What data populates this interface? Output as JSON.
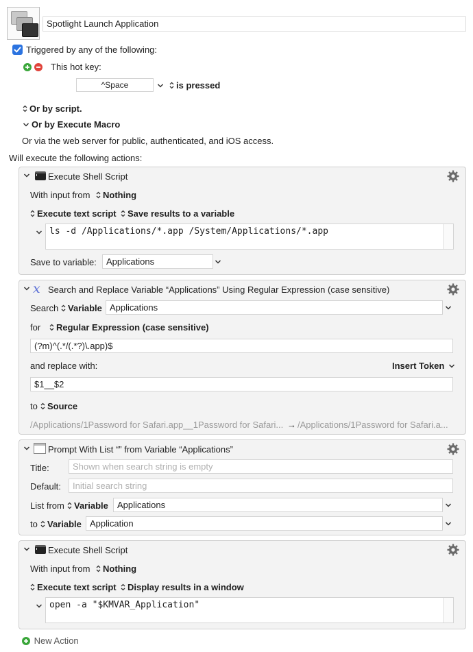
{
  "macro": {
    "name": "Spotlight Launch Application"
  },
  "trigger": {
    "label": "Triggered by any of the following:",
    "hotkey_label": "This hot key:",
    "hotkey_value": "^Space",
    "hotkey_mode": "is pressed",
    "or_script": "Or by script.",
    "or_execute_macro": "Or by Execute Macro",
    "or_web": "Or via the web server for public, authenticated, and iOS access."
  },
  "actions_label": "Will execute the following actions:",
  "action1": {
    "title": "Execute Shell Script",
    "input_from_label": "With input from",
    "input_from_value": "Nothing",
    "execute_mode": "Execute text script",
    "result_mode": "Save results to a variable",
    "script": "ls -d /Applications/*.app /System/Applications/*.app",
    "save_to_label": "Save to variable:",
    "save_to_value": "Applications"
  },
  "action2": {
    "title": "Search and Replace Variable “Applications” Using Regular Expression (case sensitive)",
    "search_label": "Search",
    "search_type": "Variable",
    "search_value": "Applications",
    "for_label": "for",
    "for_type": "Regular Expression (case sensitive)",
    "regex": "(?m)^(.*/(.*?)\\.app)$",
    "replace_label": "and replace with:",
    "insert_token": "Insert Token",
    "replacement": "$1__$2",
    "to_label": "to",
    "to_value": "Source",
    "preview_before": "/Applications/1Password for Safari.app__1Password for Safari...",
    "preview_arrow": "→",
    "preview_after": "/Applications/1Password for Safari.a..."
  },
  "action3": {
    "title": "Prompt With List “” from Variable “Applications”",
    "title_label": "Title:",
    "title_placeholder": "Shown when search string is empty",
    "default_label": "Default:",
    "default_placeholder": "Initial search string",
    "list_from_label": "List from",
    "list_from_type": "Variable",
    "list_from_value": "Applications",
    "to_label": "to",
    "to_type": "Variable",
    "to_value": "Application"
  },
  "action4": {
    "title": "Execute Shell Script",
    "input_from_label": "With input from",
    "input_from_value": "Nothing",
    "execute_mode": "Execute text script",
    "result_mode": "Display results in a window",
    "script": "open -a \"$KMVAR_Application\""
  },
  "new_action": "New Action",
  "colors": {
    "checkbox": "#2b73e0",
    "add_green": "#3aa63a",
    "remove_red": "#e0443b",
    "regex_icon": "#5b6fd6"
  },
  "icons": [
    "macro-app-icon",
    "checkbox-checked-icon",
    "add-icon",
    "remove-icon",
    "chevron-down-icon",
    "updown-icon",
    "disclosure-icon",
    "terminal-icon",
    "regex-icon",
    "prompt-window-icon",
    "gear-icon",
    "arrow-right-icon"
  ]
}
